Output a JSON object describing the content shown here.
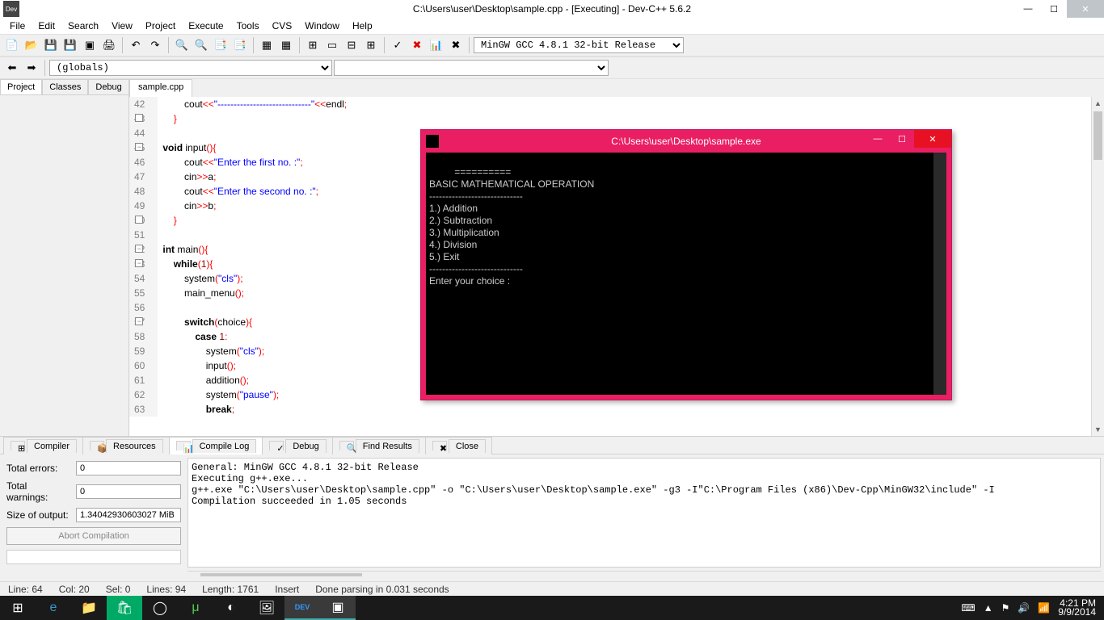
{
  "titlebar": {
    "title": "C:\\Users\\user\\Desktop\\sample.cpp - [Executing] - Dev-C++ 5.6.2"
  },
  "menu": [
    "File",
    "Edit",
    "Search",
    "View",
    "Project",
    "Execute",
    "Tools",
    "CVS",
    "Window",
    "Help"
  ],
  "compiler_select": "MinGW GCC 4.8.1 32-bit Release",
  "scope_select": "(globals)",
  "left_tabs": [
    "Project",
    "Classes",
    "Debug"
  ],
  "file_tab": "sample.cpp",
  "lines": [
    {
      "n": 42,
      "html": "        cout<span class='op'>&lt;&lt;</span><span class='s'>\"-----------------------------\"</span><span class='op'>&lt;&lt;</span>endl<span class='op'>;</span>"
    },
    {
      "n": 43,
      "fold": "",
      "html": "    <span class='p'>}</span>"
    },
    {
      "n": 44,
      "html": ""
    },
    {
      "n": 45,
      "fold": "-",
      "html": "<span class='k'>void</span> input<span class='p'>(){</span>"
    },
    {
      "n": 46,
      "html": "        cout<span class='op'>&lt;&lt;</span><span class='s'>\"Enter the first no. :\"</span><span class='op'>;</span>"
    },
    {
      "n": 47,
      "html": "        cin<span class='op'>&gt;&gt;</span>a<span class='op'>;</span>"
    },
    {
      "n": 48,
      "html": "        cout<span class='op'>&lt;&lt;</span><span class='s'>\"Enter the second no. :\"</span><span class='op'>;</span>"
    },
    {
      "n": 49,
      "html": "        cin<span class='op'>&gt;&gt;</span>b<span class='op'>;</span>"
    },
    {
      "n": 50,
      "fold": "",
      "html": "    <span class='p'>}</span>"
    },
    {
      "n": 51,
      "html": ""
    },
    {
      "n": 52,
      "fold": "-",
      "html": "<span class='k'>int</span> main<span class='p'>(){</span>"
    },
    {
      "n": 53,
      "fold": "-",
      "html": "    <span class='k'>while</span><span class='p'>(</span><span class='n'>1</span><span class='p'>){</span>"
    },
    {
      "n": 54,
      "html": "        system<span class='p'>(</span><span class='s'>\"cls\"</span><span class='p'>);</span>"
    },
    {
      "n": 55,
      "html": "        main_menu<span class='p'>();</span>"
    },
    {
      "n": 56,
      "html": ""
    },
    {
      "n": 57,
      "fold": "-",
      "html": "        <span class='k'>switch</span><span class='p'>(</span>choice<span class='p'>){</span>"
    },
    {
      "n": 58,
      "html": "            <span class='k'>case</span> <span class='n'>1</span><span class='op'>:</span>"
    },
    {
      "n": 59,
      "html": "                system<span class='p'>(</span><span class='s'>\"cls\"</span><span class='p'>);</span>"
    },
    {
      "n": 60,
      "html": "                input<span class='p'>();</span>"
    },
    {
      "n": 61,
      "html": "                addition<span class='p'>();</span>"
    },
    {
      "n": 62,
      "html": "                system<span class='p'>(</span><span class='s'>\"pause\"</span><span class='p'>);</span>"
    },
    {
      "n": 63,
      "html": "                <span class='k'>break</span><span class='op'>;</span>"
    }
  ],
  "bottom_tabs": [
    "Compiler",
    "Resources",
    "Compile Log",
    "Debug",
    "Find Results",
    "Close"
  ],
  "bottom_active": 2,
  "stats": {
    "errors_label": "Total errors:",
    "errors": "0",
    "warnings_label": "Total warnings:",
    "warnings": "0",
    "size_label": "Size of output:",
    "size": "1.34042930603027 MiB",
    "abort": "Abort Compilation"
  },
  "log": "General: MinGW GCC 4.8.1 32-bit Release\nExecuting g++.exe...\ng++.exe \"C:\\Users\\user\\Desktop\\sample.cpp\" -o \"C:\\Users\\user\\Desktop\\sample.exe\" -g3 -I\"C:\\Program Files (x86)\\Dev-Cpp\\MinGW32\\include\" -I\nCompilation succeeded in 1.05 seconds",
  "status": {
    "line": "Line:   64",
    "col": "Col:   20",
    "sel": "Sel:   0",
    "lines": "Lines:   94",
    "length": "Length:  1761",
    "insert": "Insert",
    "msg": "Done parsing in 0.031 seconds"
  },
  "console": {
    "title": "C:\\Users\\user\\Desktop\\sample.exe",
    "body": "==========\nBASIC MATHEMATICAL OPERATION\n-----------------------------\n1.) Addition\n2.) Subtraction\n3.) Multiplication\n4.) Division\n5.) Exit\n-----------------------------\nEnter your choice :"
  },
  "tray": {
    "time": "4:21 PM",
    "date": "9/9/2014"
  }
}
